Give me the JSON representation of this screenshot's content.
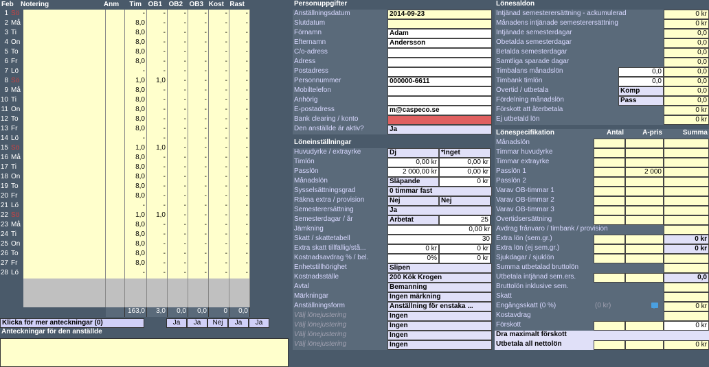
{
  "cal": {
    "headers": {
      "month": "Feb",
      "notering": "Notering",
      "anm": "Anm",
      "tim": "Tim",
      "ob1": "OB1",
      "ob2": "OB2",
      "ob3": "OB3",
      "kost": "Kost",
      "rast": "Rast"
    },
    "rows": [
      {
        "n": "1",
        "d": "Sö",
        "sun": true,
        "tim": "-",
        "ob1": "-",
        "ob2": "-",
        "ob3": "-",
        "kost": "-",
        "rast": "-"
      },
      {
        "n": "2",
        "d": "Må",
        "tim": "8,0",
        "ob1": "-",
        "ob2": "-",
        "ob3": "-",
        "kost": "-",
        "rast": "-"
      },
      {
        "n": "3",
        "d": "Ti",
        "tim": "8,0",
        "ob1": "-",
        "ob2": "-",
        "ob3": "-",
        "kost": "-",
        "rast": "-"
      },
      {
        "n": "4",
        "d": "On",
        "tim": "8,0",
        "ob1": "-",
        "ob2": "-",
        "ob3": "-",
        "kost": "-",
        "rast": "-"
      },
      {
        "n": "5",
        "d": "To",
        "tim": "8,0",
        "ob1": "-",
        "ob2": "-",
        "ob3": "-",
        "kost": "-",
        "rast": "-"
      },
      {
        "n": "6",
        "d": "Fr",
        "tim": "8,0",
        "ob1": "-",
        "ob2": "-",
        "ob3": "-",
        "kost": "-",
        "rast": "-"
      },
      {
        "n": "7",
        "d": "Lö",
        "tim": "-",
        "ob1": "-",
        "ob2": "-",
        "ob3": "-",
        "kost": "-",
        "rast": "-"
      },
      {
        "n": "8",
        "d": "Sö",
        "sun": true,
        "tim": "1,0",
        "ob1": "1,0",
        "ob2": "-",
        "ob3": "-",
        "kost": "-",
        "rast": "-"
      },
      {
        "n": "9",
        "d": "Må",
        "tim": "8,0",
        "ob1": "-",
        "ob2": "-",
        "ob3": "-",
        "kost": "-",
        "rast": "-"
      },
      {
        "n": "10",
        "d": "Ti",
        "tim": "8,0",
        "ob1": "-",
        "ob2": "-",
        "ob3": "-",
        "kost": "-",
        "rast": "-"
      },
      {
        "n": "11",
        "d": "On",
        "tim": "8,0",
        "ob1": "-",
        "ob2": "-",
        "ob3": "-",
        "kost": "-",
        "rast": "-"
      },
      {
        "n": "12",
        "d": "To",
        "tim": "8,0",
        "ob1": "-",
        "ob2": "-",
        "ob3": "-",
        "kost": "-",
        "rast": "-"
      },
      {
        "n": "13",
        "d": "Fr",
        "tim": "8,0",
        "ob1": "-",
        "ob2": "-",
        "ob3": "-",
        "kost": "-",
        "rast": "-"
      },
      {
        "n": "14",
        "d": "Lö",
        "tim": "-",
        "ob1": "-",
        "ob2": "-",
        "ob3": "-",
        "kost": "-",
        "rast": "-"
      },
      {
        "n": "15",
        "d": "Sö",
        "sun": true,
        "tim": "1,0",
        "ob1": "1,0",
        "ob2": "-",
        "ob3": "-",
        "kost": "-",
        "rast": "-"
      },
      {
        "n": "16",
        "d": "Må",
        "tim": "8,0",
        "ob1": "-",
        "ob2": "-",
        "ob3": "-",
        "kost": "-",
        "rast": "-"
      },
      {
        "n": "17",
        "d": "Ti",
        "tim": "8,0",
        "ob1": "-",
        "ob2": "-",
        "ob3": "-",
        "kost": "-",
        "rast": "-"
      },
      {
        "n": "18",
        "d": "On",
        "tim": "8,0",
        "ob1": "-",
        "ob2": "-",
        "ob3": "-",
        "kost": "-",
        "rast": "-"
      },
      {
        "n": "19",
        "d": "To",
        "tim": "8,0",
        "ob1": "-",
        "ob2": "-",
        "ob3": "-",
        "kost": "-",
        "rast": "-"
      },
      {
        "n": "20",
        "d": "Fr",
        "tim": "8,0",
        "ob1": "-",
        "ob2": "-",
        "ob3": "-",
        "kost": "-",
        "rast": "-"
      },
      {
        "n": "21",
        "d": "Lö",
        "tim": "-",
        "ob1": "-",
        "ob2": "-",
        "ob3": "-",
        "kost": "-",
        "rast": "-"
      },
      {
        "n": "22",
        "d": "Sö",
        "sun": true,
        "tim": "1,0",
        "ob1": "1,0",
        "ob2": "-",
        "ob3": "-",
        "kost": "-",
        "rast": "-"
      },
      {
        "n": "23",
        "d": "Må",
        "tim": "8,0",
        "ob1": "-",
        "ob2": "-",
        "ob3": "-",
        "kost": "-",
        "rast": "-"
      },
      {
        "n": "24",
        "d": "Ti",
        "tim": "8,0",
        "ob1": "-",
        "ob2": "-",
        "ob3": "-",
        "kost": "-",
        "rast": "-"
      },
      {
        "n": "25",
        "d": "On",
        "tim": "8,0",
        "ob1": "-",
        "ob2": "-",
        "ob3": "-",
        "kost": "-",
        "rast": "-"
      },
      {
        "n": "26",
        "d": "To",
        "tim": "8,0",
        "ob1": "-",
        "ob2": "-",
        "ob3": "-",
        "kost": "-",
        "rast": "-"
      },
      {
        "n": "27",
        "d": "Fr",
        "tim": "8,0",
        "ob1": "-",
        "ob2": "-",
        "ob3": "-",
        "kost": "-",
        "rast": "-"
      },
      {
        "n": "28",
        "d": "Lö",
        "tim": "-",
        "ob1": "-",
        "ob2": "-",
        "ob3": "-",
        "kost": "-",
        "rast": "-"
      }
    ],
    "totals": {
      "tim": "163,0",
      "ob1": "3,0",
      "ob2": "0,0",
      "ob3": "0,0",
      "kost": "0",
      "rast": "0,0"
    },
    "klicka": "Klicka för mer anteckningar (0)",
    "anteck_header": "Anteckningar för den anställde",
    "ja1": "Ja",
    "ja2": "Ja",
    "nej": "Nej",
    "ja3": "Ja",
    "ja4": "Ja"
  },
  "person": {
    "title": "Personuppgifter",
    "rows": [
      {
        "l": "Anställningsdatum",
        "v": "2014-09-23",
        "cls": "yel bold"
      },
      {
        "l": "Slutdatum",
        "v": "",
        "cls": "yel"
      },
      {
        "l": "Förnamn",
        "v": "Adam",
        "cls": "blank bold"
      },
      {
        "l": "Efternamn",
        "v": "Andersson",
        "cls": "blank bold"
      },
      {
        "l": "C/o-adress",
        "v": "",
        "cls": "blank"
      },
      {
        "l": "Adress",
        "v": "",
        "cls": "blank"
      },
      {
        "l": "Postadress",
        "v": "",
        "cls": "blank"
      },
      {
        "l": "Personnummer",
        "v": "000000-6611",
        "cls": "blank bold"
      },
      {
        "l": "Mobiltelefon",
        "v": "",
        "cls": "blank"
      },
      {
        "l": "Anhörig",
        "v": "",
        "cls": "blank"
      },
      {
        "l": "E-postadress",
        "v": "m@caspeco.se",
        "cls": "blank bold"
      },
      {
        "l": "Bank clearing / konto",
        "v": "",
        "cls": "red"
      },
      {
        "l": "Den anställde är aktiv?",
        "v": "Ja",
        "cls": "lav bold"
      }
    ]
  },
  "lone": {
    "title": "Löneinställningar",
    "rows": [
      {
        "l": "Huvudyrke / extrayrke",
        "v1": "Dj",
        "v2": "*Inget",
        "split": true
      },
      {
        "l": "Timlön",
        "v1": "0,00 kr",
        "v2": "0,00 kr",
        "split": true,
        "right": true
      },
      {
        "l": "Passlön",
        "v1": "2 000,00 kr",
        "v2": "0,00 kr",
        "split": true,
        "right": true
      },
      {
        "l": "Månadslön",
        "v1": "Släpande",
        "v2": "0 kr",
        "split": true,
        "right2": true
      },
      {
        "l": "Sysselsättningsgrad",
        "v": "0 timmar fast",
        "cls": "lav bold"
      },
      {
        "l": "Räkna extra / provision",
        "v1": "Nej",
        "v2": "Nej",
        "split": true,
        "lav": true
      },
      {
        "l": "Semesterersättning",
        "v": "Ja",
        "cls": "lav bold"
      },
      {
        "l": "Semesterdagar / år",
        "v1": "Arbetat",
        "v2": "25",
        "split": true,
        "right2": true
      },
      {
        "l": "Jämkning",
        "v": "0,00 kr",
        "cls": "right"
      },
      {
        "l": "Skatt / skattetabell",
        "v": "30",
        "cls": "right"
      },
      {
        "l": "Extra skatt tillfällig/stå...",
        "v1": "0 kr",
        "v2": "0 kr",
        "split": true,
        "right": true
      },
      {
        "l": "Kostnadsavdrag % / bel.",
        "v1": "0%",
        "v2": "0 kr",
        "split": true,
        "right": true
      },
      {
        "l": "Enhetstillhörighet",
        "v": "Slipen",
        "cls": "lav bold"
      },
      {
        "l": "Kostnadsställe",
        "v": "200 Kök Krogen",
        "cls": "lav bold"
      },
      {
        "l": "Avtal",
        "v": "Bemanning",
        "cls": "lav bold"
      },
      {
        "l": "Märkningar",
        "v": "Ingen märkning",
        "cls": "lav bold"
      },
      {
        "l": "Anställningsform",
        "v": "Anställning för enstaka ...",
        "cls": "lav bold"
      },
      {
        "l": "Välj lönejustering",
        "dim": true,
        "v": "Ingen",
        "cls": "lav bold"
      },
      {
        "l": "Välj lönejustering",
        "dim": true,
        "v": "Ingen",
        "cls": "lav bold"
      },
      {
        "l": "Välj lönejustering",
        "dim": true,
        "v": "Ingen",
        "cls": "lav bold"
      },
      {
        "l": "Välj lönejustering",
        "dim": true,
        "v": "Ingen",
        "cls": "lav bold"
      }
    ]
  },
  "saldon": {
    "title": "Lönesaldon",
    "rows": [
      {
        "l": "Intjänad semesterersättning - ackumulerad",
        "v3": "0 kr"
      },
      {
        "l": "Månadens intjänade semesterersättning",
        "v3": "0 kr"
      },
      {
        "l": "Intjänade semesterdagar",
        "v3": "0,0"
      },
      {
        "l": "Obetalda semesterdagar",
        "v3": "0,0"
      },
      {
        "l": "Betalda semesterdagar",
        "v3": "0,0"
      },
      {
        "l": "Samtliga sparade dagar",
        "v3": "0,0"
      },
      {
        "l": "Timbalans månadslön",
        "vw": "0,0",
        "v3": "0,0"
      },
      {
        "l": "Timbank timlön",
        "vw": "0,0",
        "v3": "0,0"
      },
      {
        "l": "Övertid / utbetala",
        "vlav": "Komp",
        "v3": "0,0"
      },
      {
        "l": "Fördelning månadslön",
        "vlav": "Pass",
        "v3": "0,0"
      },
      {
        "l": "Förskott att återbetala",
        "v3": "0 kr"
      },
      {
        "l": "Ej utbetald lön",
        "v3": "0 kr"
      }
    ]
  },
  "spec": {
    "title": "Lönespecifikation",
    "headers": {
      "antal": "Antal",
      "apris": "À-pris",
      "summa": "Summa"
    },
    "rows": [
      {
        "l": "Månadslön",
        "v1": "",
        "v2": "",
        "v3": ""
      },
      {
        "l": "Timmar huvudyrke",
        "v1": "",
        "v2": "",
        "v3": ""
      },
      {
        "l": "Timmar extrayrke",
        "v1": "",
        "v2": "",
        "v3": ""
      },
      {
        "l": "Passlön 1",
        "v1": "",
        "v2": "2 000",
        "v3": ""
      },
      {
        "l": "Passlön 2",
        "v1": "",
        "v2": "",
        "v3": ""
      },
      {
        "l": "Varav OB-timmar 1",
        "v1": "",
        "v2": "",
        "v3": ""
      },
      {
        "l": "Varav OB-timmar 2",
        "v1": "",
        "v2": "",
        "v3": ""
      },
      {
        "l": "Varav OB-timmar 3",
        "v1": "",
        "v2": "",
        "v3": ""
      },
      {
        "l": "Övertidsersättning",
        "v1": "",
        "v2": "",
        "v3": ""
      },
      {
        "l": "Avdrag frånvaro / timbank / provision",
        "span": true
      },
      {
        "l": "Extra lön (sem.gr.)",
        "v1": "",
        "v2": "",
        "v3": "0 kr",
        "lav": true
      },
      {
        "l": "Extra lön (ej sem.gr.)",
        "v1": "",
        "v2": "",
        "v3": "0 kr",
        "lav": true
      },
      {
        "l": "Sjukdagar / sjuklön",
        "v1": "",
        "v2": "",
        "v3": ""
      },
      {
        "l": "Summa utbetalad bruttolön",
        "span": true
      },
      {
        "l": "Utbetala intjänad sem.ers.",
        "v3": "0,0",
        "lav": true
      },
      {
        "l": "Bruttolön inklusive sem.",
        "span": true
      },
      {
        "l": "Skatt",
        "span": true
      },
      {
        "l": "Engångsskatt (0 %)",
        "mid": "(0 kr)",
        "v3": "0 kr",
        "comment": true
      },
      {
        "l": "Kostavdrag",
        "span": true
      },
      {
        "l": "Förskott",
        "v3": "0 kr",
        "white": true
      },
      {
        "l": "Dra maximalt förskott",
        "lav": true,
        "full": true
      },
      {
        "l": "Utbetala all nettolön",
        "v3": "0 kr",
        "lavlab": true
      }
    ]
  }
}
